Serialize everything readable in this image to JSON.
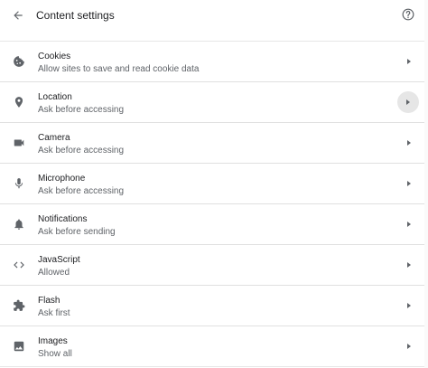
{
  "header": {
    "title": "Content settings",
    "back_icon": "arrow-left-icon",
    "help_icon": "help-circle-icon"
  },
  "rows": [
    {
      "name": "Cookies",
      "sub": "Allow sites to save and read cookie data",
      "icon": "cookie-icon"
    },
    {
      "name": "Location",
      "sub": "Ask before accessing",
      "icon": "location-pin-icon"
    },
    {
      "name": "Camera",
      "sub": "Ask before accessing",
      "icon": "camera-icon"
    },
    {
      "name": "Microphone",
      "sub": "Ask before accessing",
      "icon": "microphone-icon"
    },
    {
      "name": "Notifications",
      "sub": "Ask before sending",
      "icon": "bell-icon"
    },
    {
      "name": "JavaScript",
      "sub": "Allowed",
      "icon": "code-icon"
    },
    {
      "name": "Flash",
      "sub": "Ask first",
      "icon": "puzzle-icon"
    },
    {
      "name": "Images",
      "sub": "Show all",
      "icon": "image-icon"
    }
  ],
  "colors": {
    "text": "#202124",
    "secondary": "#5f6368",
    "divider": "#e0e0e0",
    "hover": "#e6e6e6"
  }
}
